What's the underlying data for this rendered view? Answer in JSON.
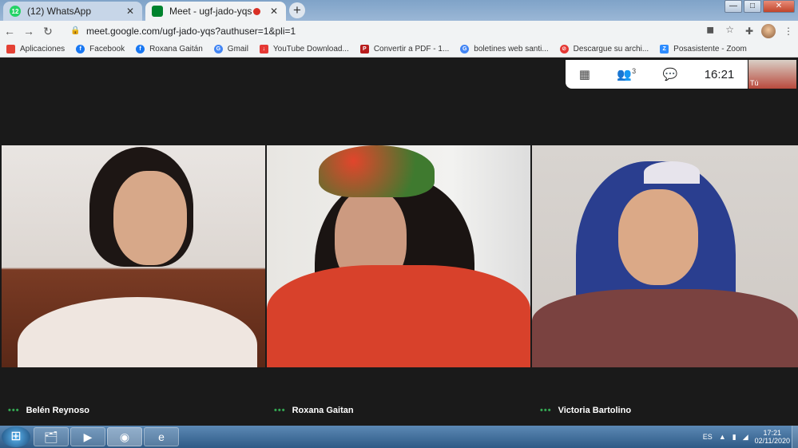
{
  "tabs": [
    {
      "title": "(12) WhatsApp",
      "favicon_label": "12",
      "favicon_color": "#25d366",
      "close": "✕"
    },
    {
      "title": "Meet - ugf-jado-yqs",
      "favicon_label": "",
      "favicon_color": "#00832d",
      "close": "✕"
    }
  ],
  "new_tab_label": "+",
  "window_controls": {
    "minimize": "—",
    "maximize": "□",
    "close": "✕"
  },
  "address": {
    "url": "meet.google.com/ugf-jado-yqs?authuser=1&pli=1",
    "back": "←",
    "forward": "→",
    "reload": "↻"
  },
  "omni_icons": {
    "camera": "◼",
    "star": "☆"
  },
  "ext_icons": {
    "puzzle": "✚",
    "menu": "⋮"
  },
  "bookmarks": [
    {
      "label": "Aplicaciones",
      "color": "#e44134",
      "glyph": ""
    },
    {
      "label": "Facebook",
      "color": "#1877f2",
      "glyph": "f"
    },
    {
      "label": "Roxana Gaitán",
      "color": "#1877f2",
      "glyph": "f"
    },
    {
      "label": "Gmail",
      "color": "#4285f4",
      "glyph": "G"
    },
    {
      "label": "YouTube Download...",
      "color": "#e53935",
      "glyph": "↓"
    },
    {
      "label": "Convertir a PDF - 1...",
      "color": "#b71c1c",
      "glyph": "P"
    },
    {
      "label": "boletines web santi...",
      "color": "#4285f4",
      "glyph": "G"
    },
    {
      "label": "Descargue su archi...",
      "color": "#e53935",
      "glyph": "⊘"
    },
    {
      "label": "Posasistente - Zoom",
      "color": "#2d8cff",
      "glyph": "Z"
    }
  ],
  "meet": {
    "time": "16:21",
    "people_count": "3",
    "self_label": "Tú",
    "controls": {
      "grid": "▦",
      "people": "👥",
      "chat": "💬"
    }
  },
  "participants": [
    {
      "name": "Belén Reynoso"
    },
    {
      "name": "Roxana Gaitan"
    },
    {
      "name": "Victoria Bartolino"
    }
  ],
  "name_dots": "•••",
  "taskbar": {
    "start": "⊞",
    "apps": [
      "🗂",
      "▶",
      "◉",
      "e"
    ],
    "lang": "ES",
    "tray_arrow": "▲",
    "clock_time": "17:21",
    "clock_date": "02/11/2020"
  }
}
